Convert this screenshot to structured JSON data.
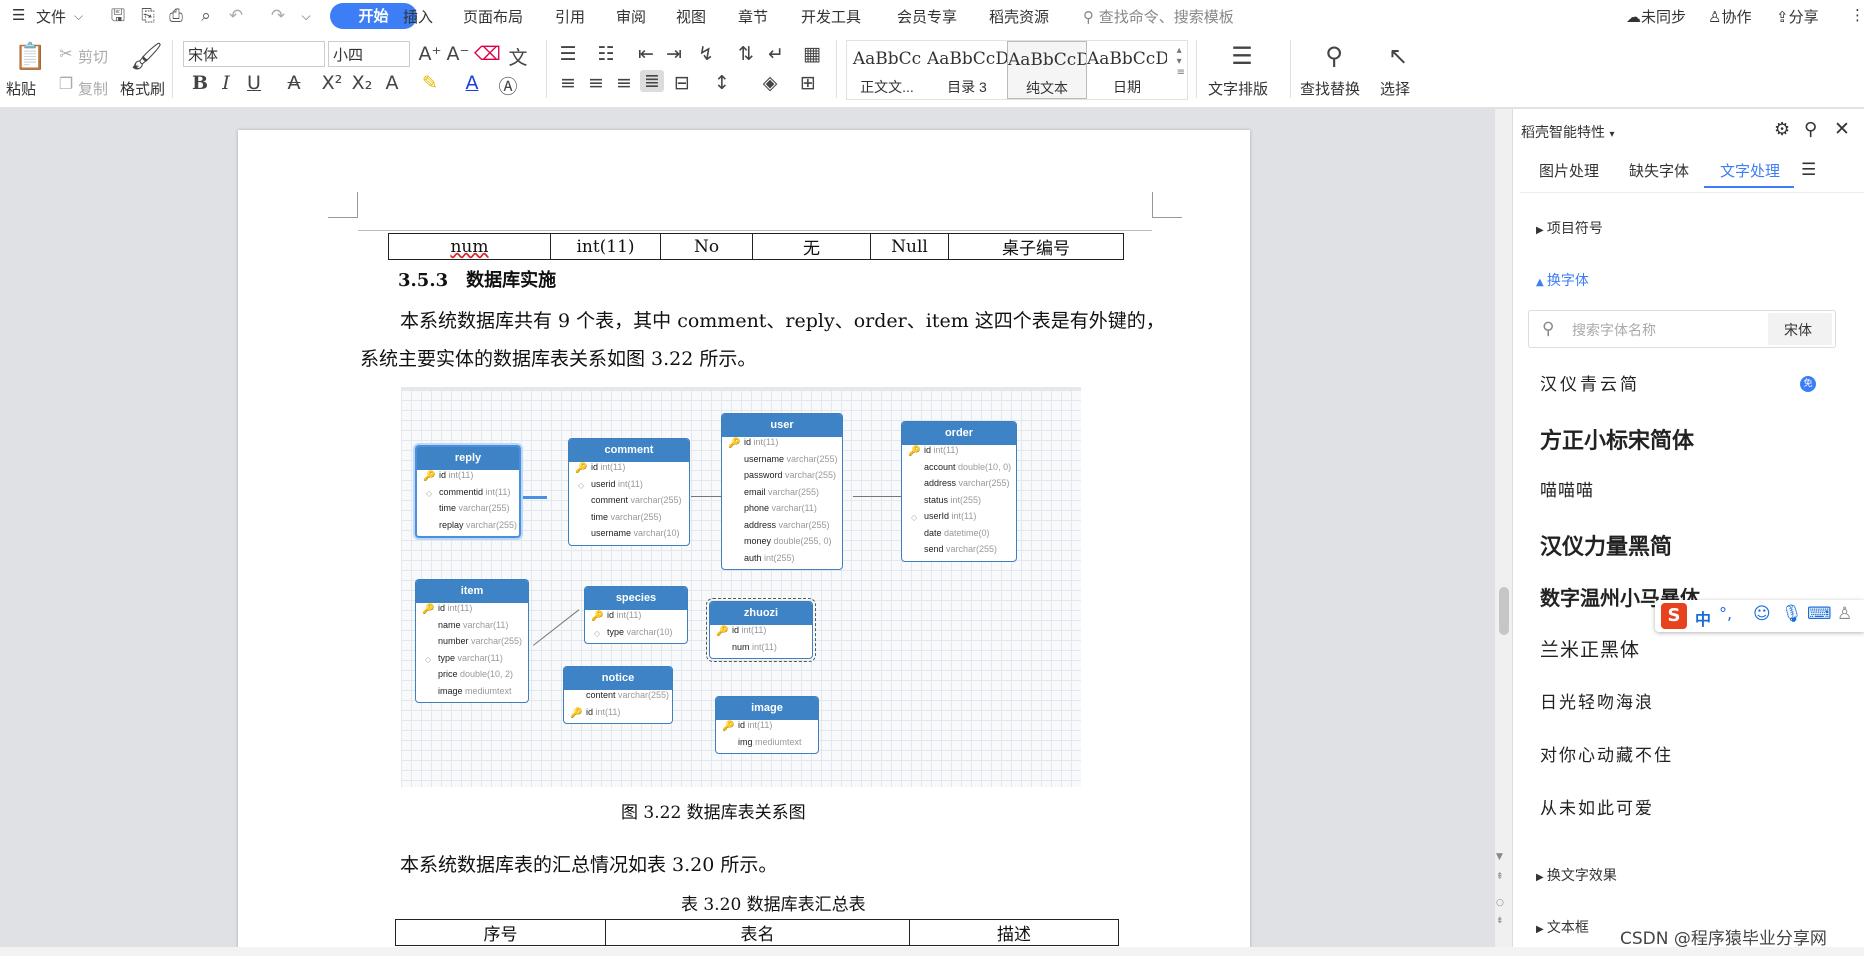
{
  "menubar": {
    "menu_label": "文件",
    "start_tab": "开始",
    "tabs": [
      "插入",
      "页面布局",
      "引用",
      "审阅",
      "视图",
      "章节",
      "开发工具",
      "会员专享",
      "稻壳资源"
    ],
    "search_placeholder": "查找命令、搜索模板",
    "sync": "未同步",
    "collab": "协作",
    "share": "分享"
  },
  "ribbon": {
    "paste": "粘贴",
    "cut": "剪切",
    "copy": "复制",
    "format_painter": "格式刷",
    "font_name": "宋体",
    "font_size": "小四",
    "bold": "B",
    "italic": "I",
    "underline": "U",
    "styles": [
      {
        "preview": "AaBbCc",
        "name": "正文文..."
      },
      {
        "preview": "AaBbCcDd",
        "name": "目录 3"
      },
      {
        "preview": "AaBbCcDd",
        "name": "纯文本"
      },
      {
        "preview": "AaBbCcDd",
        "name": "日期"
      }
    ],
    "text_layout": "文字排版",
    "find_replace": "查找替换",
    "select": "选择"
  },
  "document": {
    "table_row": [
      "num",
      "int(11)",
      "No",
      "无",
      "Null",
      "桌子编号"
    ],
    "heading": "3.5.3　数据库实施",
    "para1_line1": "本系统数据库共有 9 个表，其中 comment、reply、order、item 这四个表是有外键的，",
    "para1_line2": "系统主要实体的数据库表关系如图 3.22 所示。",
    "figure_caption": "图 3.22  数据库表关系图",
    "para2": "本系统数据库表的汇总情况如表 3.20 所示。",
    "table2_caption": "表 3.20  数据库表汇总表",
    "table2_headers": [
      "序号",
      "表名",
      "描述"
    ]
  },
  "erd": {
    "entities": [
      {
        "name": "reply",
        "fields": [
          {
            "n": "id",
            "t": "int(11)",
            "k": "pk"
          },
          {
            "n": "commentid",
            "t": "int(11)",
            "k": "fk"
          },
          {
            "n": "time",
            "t": "varchar(255)",
            "k": ""
          },
          {
            "n": "replay",
            "t": "varchar(255)",
            "k": ""
          }
        ]
      },
      {
        "name": "comment",
        "fields": [
          {
            "n": "id",
            "t": "int(11)",
            "k": "pk"
          },
          {
            "n": "userid",
            "t": "int(11)",
            "k": "fk"
          },
          {
            "n": "comment",
            "t": "varchar(255)",
            "k": ""
          },
          {
            "n": "time",
            "t": "varchar(255)",
            "k": ""
          },
          {
            "n": "username",
            "t": "varchar(10)",
            "k": ""
          }
        ]
      },
      {
        "name": "user",
        "fields": [
          {
            "n": "id",
            "t": "int(11)",
            "k": "pk"
          },
          {
            "n": "username",
            "t": "varchar(255)",
            "k": ""
          },
          {
            "n": "password",
            "t": "varchar(255)",
            "k": ""
          },
          {
            "n": "email",
            "t": "varchar(255)",
            "k": ""
          },
          {
            "n": "phone",
            "t": "varchar(11)",
            "k": ""
          },
          {
            "n": "address",
            "t": "varchar(255)",
            "k": ""
          },
          {
            "n": "money",
            "t": "double(255, 0)",
            "k": ""
          },
          {
            "n": "auth",
            "t": "int(255)",
            "k": ""
          }
        ]
      },
      {
        "name": "order",
        "fields": [
          {
            "n": "id",
            "t": "int(11)",
            "k": "pk"
          },
          {
            "n": "account",
            "t": "double(10, 0)",
            "k": ""
          },
          {
            "n": "address",
            "t": "varchar(255)",
            "k": ""
          },
          {
            "n": "status",
            "t": "int(255)",
            "k": ""
          },
          {
            "n": "userId",
            "t": "int(11)",
            "k": "fk"
          },
          {
            "n": "date",
            "t": "datetime(0)",
            "k": ""
          },
          {
            "n": "send",
            "t": "varchar(255)",
            "k": ""
          }
        ]
      },
      {
        "name": "item",
        "fields": [
          {
            "n": "id",
            "t": "int(11)",
            "k": "pk"
          },
          {
            "n": "name",
            "t": "varchar(11)",
            "k": ""
          },
          {
            "n": "number",
            "t": "varchar(255)",
            "k": ""
          },
          {
            "n": "type",
            "t": "varchar(11)",
            "k": "fk"
          },
          {
            "n": "price",
            "t": "double(10, 2)",
            "k": ""
          },
          {
            "n": "image",
            "t": "mediumtext",
            "k": ""
          }
        ]
      },
      {
        "name": "species",
        "fields": [
          {
            "n": "id",
            "t": "int(11)",
            "k": "pk"
          },
          {
            "n": "type",
            "t": "varchar(10)",
            "k": "fk"
          }
        ]
      },
      {
        "name": "zhuozi",
        "fields": [
          {
            "n": "id",
            "t": "int(11)",
            "k": "pk"
          },
          {
            "n": "num",
            "t": "int(11)",
            "k": ""
          }
        ]
      },
      {
        "name": "notice",
        "fields": [
          {
            "n": "content",
            "t": "varchar(255)",
            "k": ""
          },
          {
            "n": "id",
            "t": "int(11)",
            "k": "pk"
          }
        ]
      },
      {
        "name": "image",
        "fields": [
          {
            "n": "id",
            "t": "int(11)",
            "k": "pk"
          },
          {
            "n": "img",
            "t": "mediumtext",
            "k": ""
          }
        ]
      }
    ]
  },
  "panel": {
    "title": "稻壳智能特性",
    "tabs": [
      "图片处理",
      "缺失字体",
      "文字处理"
    ],
    "section_bullets": "项目符号",
    "section_font": "换字体",
    "font_search_placeholder": "搜索字体名称",
    "current_font": "宋体",
    "fonts": [
      "汉仪青云简",
      "方正小标宋简体",
      "喵喵喵",
      "汉仪力量黑简",
      "数字温州小马暴体",
      "兰米正黑体",
      "日光轻吻海浪",
      "对你心动藏不住",
      "从未如此可爱"
    ],
    "section_effect": "换文字效果",
    "section_textbox": "文本框"
  },
  "ime": {
    "label": "中"
  },
  "watermark": "CSDN @程序猿毕业分享网",
  "colors": {
    "accent": "#3d7df5",
    "erd_header": "#3d83c5"
  }
}
